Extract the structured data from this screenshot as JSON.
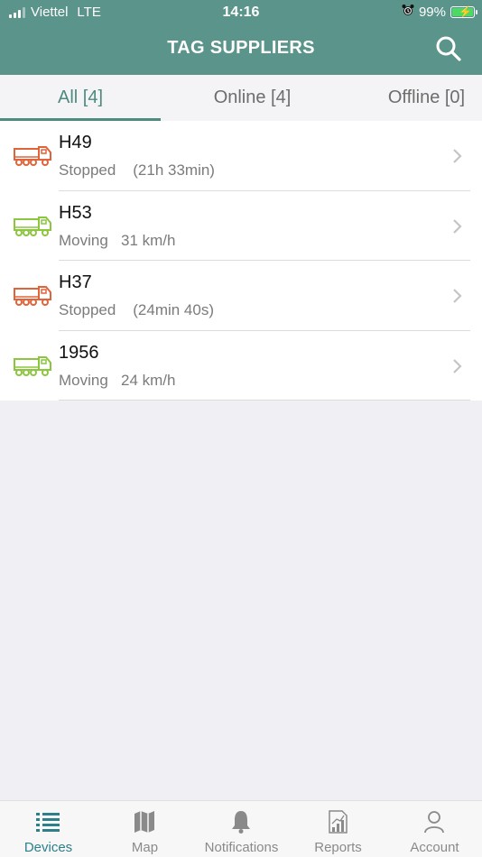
{
  "status_bar": {
    "carrier": "Viettel",
    "network": "LTE",
    "time": "14:16",
    "battery": "99%"
  },
  "header": {
    "title": "TAG SUPPLIERS",
    "search_icon": "search-icon"
  },
  "tabs": [
    {
      "label": "All [4]",
      "active": true
    },
    {
      "label": "Online [4]",
      "active": false
    },
    {
      "label": "Offline [0]",
      "active": false
    }
  ],
  "colors": {
    "brand": "#5a948a",
    "stopped": "#e0633a",
    "moving": "#8cc63f",
    "active_tab": "#2d7f8a"
  },
  "devices": [
    {
      "name": "H49",
      "status": "Stopped",
      "detail": "(21h 33min)",
      "state": "stopped"
    },
    {
      "name": "H53",
      "status": "Moving",
      "detail": "31 km/h",
      "state": "moving"
    },
    {
      "name": "H37",
      "status": "Stopped",
      "detail": "(24min 40s)",
      "state": "stopped"
    },
    {
      "name": "1956",
      "status": "Moving",
      "detail": "24 km/h",
      "state": "moving"
    }
  ],
  "tabbar": [
    {
      "label": "Devices",
      "icon": "list-icon",
      "active": true
    },
    {
      "label": "Map",
      "icon": "map-icon",
      "active": false
    },
    {
      "label": "Notifications",
      "icon": "bell-icon",
      "active": false
    },
    {
      "label": "Reports",
      "icon": "reports-icon",
      "active": false
    },
    {
      "label": "Account",
      "icon": "person-icon",
      "active": false
    }
  ]
}
